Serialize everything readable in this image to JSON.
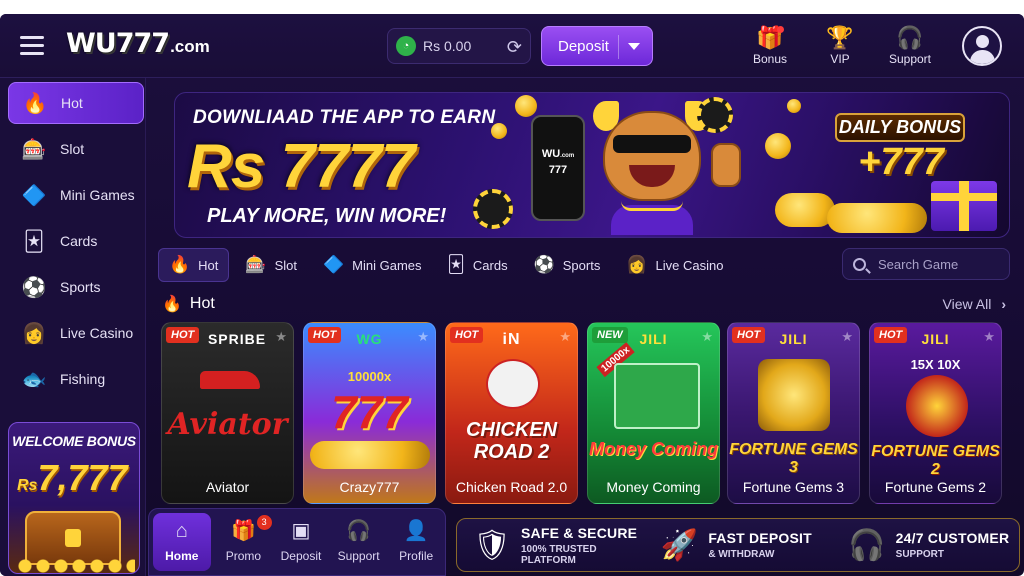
{
  "brand": {
    "logo_main": "WU777",
    "logo_suffix": ".com"
  },
  "header": {
    "balance": "Rs 0.00",
    "deposit_label": "Deposit",
    "actions": [
      {
        "label": "Bonus",
        "icon": "gift-icon"
      },
      {
        "label": "VIP",
        "icon": "trophy-icon"
      },
      {
        "label": "Support",
        "icon": "headset-icon"
      }
    ]
  },
  "sidebar": {
    "items": [
      {
        "label": "Hot",
        "icon": "fire-icon",
        "active": true
      },
      {
        "label": "Slot",
        "icon": "slot-machine-icon"
      },
      {
        "label": "Mini Games",
        "icon": "mini-games-icon"
      },
      {
        "label": "Cards",
        "icon": "playing-cards-icon"
      },
      {
        "label": "Sports",
        "icon": "soccer-ball-icon"
      },
      {
        "label": "Live Casino",
        "icon": "dealer-icon"
      },
      {
        "label": "Fishing",
        "icon": "fish-icon"
      }
    ],
    "welcome": {
      "title": "WELCOME BONUS",
      "currency": "Rs",
      "amount": "7,777"
    }
  },
  "banner": {
    "line1": "DOWNLIAAD THE APP TO EARN",
    "amount": "Rs 7777",
    "line3": "PLAY MORE, WIN MORE!",
    "phone_logo_top": "WU",
    "phone_logo_suffix": ".com",
    "phone_logo_num": "777",
    "daily_title": "DAILY BONUS",
    "daily_amount": "+777"
  },
  "categories": {
    "tabs": [
      {
        "label": "Hot",
        "icon": "fire-icon",
        "active": true
      },
      {
        "label": "Slot",
        "icon": "slot-machine-icon"
      },
      {
        "label": "Mini Games",
        "icon": "mini-games-icon"
      },
      {
        "label": "Cards",
        "icon": "playing-cards-icon"
      },
      {
        "label": "Sports",
        "icon": "soccer-ball-icon"
      },
      {
        "label": "Live Casino",
        "icon": "dealer-icon"
      }
    ],
    "search_placeholder": "Search Game"
  },
  "section": {
    "title": "Hot",
    "view_all": "View All"
  },
  "games": [
    {
      "name": "Aviator",
      "badge": "HOT",
      "provider": "SPRIBE",
      "art_text": "Aviator"
    },
    {
      "name": "Crazy777",
      "badge": "HOT",
      "provider": "WG",
      "art_text": "777",
      "art_sub": "10000x"
    },
    {
      "name": "Chicken Road 2.0",
      "badge": "HOT",
      "provider": "iN",
      "art_text": "CHICKEN ROAD 2"
    },
    {
      "name": "Money Coming",
      "badge": "NEW",
      "provider": "JILI",
      "art_text": "Money Coming",
      "art_sub": "10000x"
    },
    {
      "name": "Fortune Gems 3",
      "badge": "HOT",
      "provider": "JILI",
      "art_text": "FORTUNE GEMS 3"
    },
    {
      "name": "Fortune Gems 2",
      "badge": "HOT",
      "provider": "JILI",
      "art_text": "FORTUNE GEMS 2",
      "art_sub": "15X  10X"
    }
  ],
  "bottom_nav": {
    "items": [
      {
        "label": "Home",
        "icon": "home-icon",
        "active": true
      },
      {
        "label": "Promo",
        "icon": "gift-icon",
        "badge": "3"
      },
      {
        "label": "Deposit",
        "icon": "wallet-icon"
      },
      {
        "label": "Support",
        "icon": "headset-icon"
      },
      {
        "label": "Profile",
        "icon": "user-icon"
      }
    ]
  },
  "trust": [
    {
      "title": "SAFE & SECURE",
      "sub": "100% TRUSTED PLATFORM",
      "icon": "shield-lock-icon"
    },
    {
      "title": "FAST DEPOSIT",
      "sub": "& WITHDRAW",
      "icon": "rocket-icon"
    },
    {
      "title": "24/7 CUSTOMER",
      "sub": "SUPPORT",
      "icon": "headset-icon"
    }
  ],
  "colors": {
    "bg": "#1c0f3d",
    "accent": "#7a37e6",
    "gold": "#ffd43a",
    "hot_badge": "#e2301f",
    "new_badge": "#1e9e3a"
  }
}
